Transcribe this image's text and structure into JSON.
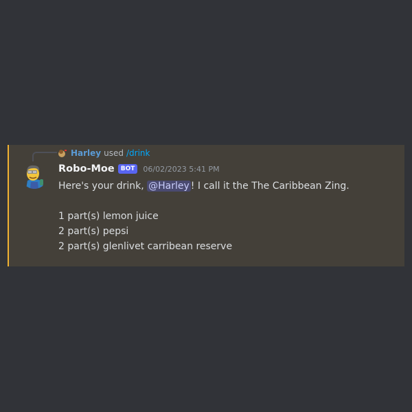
{
  "reply": {
    "user": "Harley",
    "used_text": "used",
    "command": "/drink"
  },
  "message": {
    "username": "Robo-Moe",
    "bot_tag": "BOT",
    "timestamp": "06/02/2023 5:41 PM",
    "intro_before": "Here's your drink, ",
    "mention": "@Harley",
    "intro_after": "! I call it the The Caribbean Zing.",
    "ingredients": [
      "1 part(s) lemon juice",
      "2 part(s) pepsi",
      "2 part(s) glenlivet carribean reserve"
    ]
  },
  "colors": {
    "background": "#313338",
    "highlight_background": "#444039",
    "highlight_border": "#f0b232",
    "bot_tag": "#5865f2",
    "mention_text": "#c9cdfb",
    "command_link": "#00a8fc"
  }
}
